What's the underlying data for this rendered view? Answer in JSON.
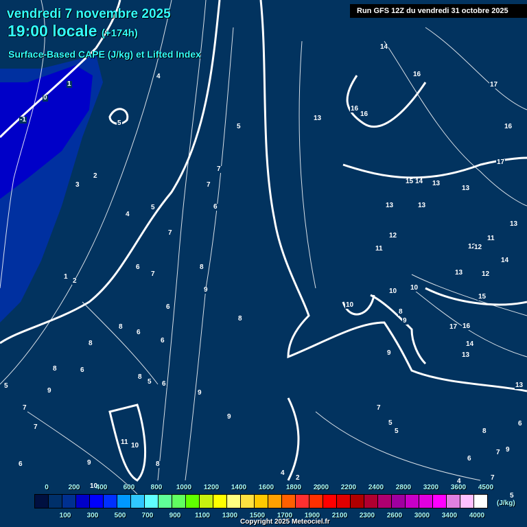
{
  "header": {
    "date": "vendredi 7 novembre 2025",
    "time": "19:00 locale",
    "lead": "(+174h)",
    "parameter": "Surface-Based CAPE (J/kg) et Lifted Index",
    "run": "Run GFS 12Z du vendredi 31 octobre 2025"
  },
  "contour_labels": [
    "0",
    "-1",
    "1",
    "4",
    "5",
    "5",
    "3",
    "2",
    "4",
    "5",
    "7",
    "7",
    "6",
    "7",
    "7",
    "8",
    "6",
    "9",
    "6",
    "8",
    "6",
    "8",
    "6",
    "8",
    "5",
    "6",
    "8",
    "9",
    "1",
    "2",
    "8",
    "6",
    "9",
    "9",
    "7",
    "7",
    "6",
    "9",
    "11",
    "10",
    "8",
    "10",
    "13",
    "14",
    "16",
    "16",
    "16",
    "17",
    "17",
    "16",
    "15",
    "14",
    "13",
    "13",
    "13",
    "13",
    "12",
    "11",
    "12",
    "12",
    "11",
    "14",
    "13",
    "10",
    "10",
    "10",
    "13",
    "12",
    "15",
    "8",
    "9",
    "17",
    "16",
    "14",
    "13",
    "9",
    "13",
    "7",
    "5",
    "5",
    "8",
    "9",
    "7",
    "6",
    "5",
    "6",
    "5",
    "4",
    "2",
    "3",
    "4",
    "7"
  ],
  "legend": {
    "colors": [
      "#001040",
      "#00306a",
      "#003090",
      "#0000c8",
      "#0000ff",
      "#0030ff",
      "#0098ff",
      "#30c8ff",
      "#60ffff",
      "#60ff98",
      "#60ff60",
      "#60ff00",
      "#c8f010",
      "#ffff00",
      "#ffff80",
      "#ffe040",
      "#ffc800",
      "#ffa000",
      "#ff6000",
      "#ff3030",
      "#ff3000",
      "#ff0000",
      "#e00000",
      "#b00000",
      "#b00030",
      "#b00070",
      "#a000a0",
      "#c800c8",
      "#e000e0",
      "#ff00ff",
      "#e080e0",
      "#ffc0ff",
      "#ffffff"
    ],
    "top_ticks": [
      "0",
      "200",
      "400",
      "600",
      "800",
      "1000",
      "1200",
      "1400",
      "1600",
      "1800",
      "2000",
      "2200",
      "2400",
      "2800",
      "3200",
      "3600",
      "4500"
    ],
    "bottom_ticks": [
      "100",
      "300",
      "500",
      "700",
      "900",
      "1100",
      "1300",
      "1500",
      "1700",
      "1900",
      "2100",
      "2300",
      "2600",
      "3000",
      "3400",
      "4000"
    ],
    "unit": "(J/kg)"
  },
  "copyright": "Copyright 2025 Meteociel.fr"
}
